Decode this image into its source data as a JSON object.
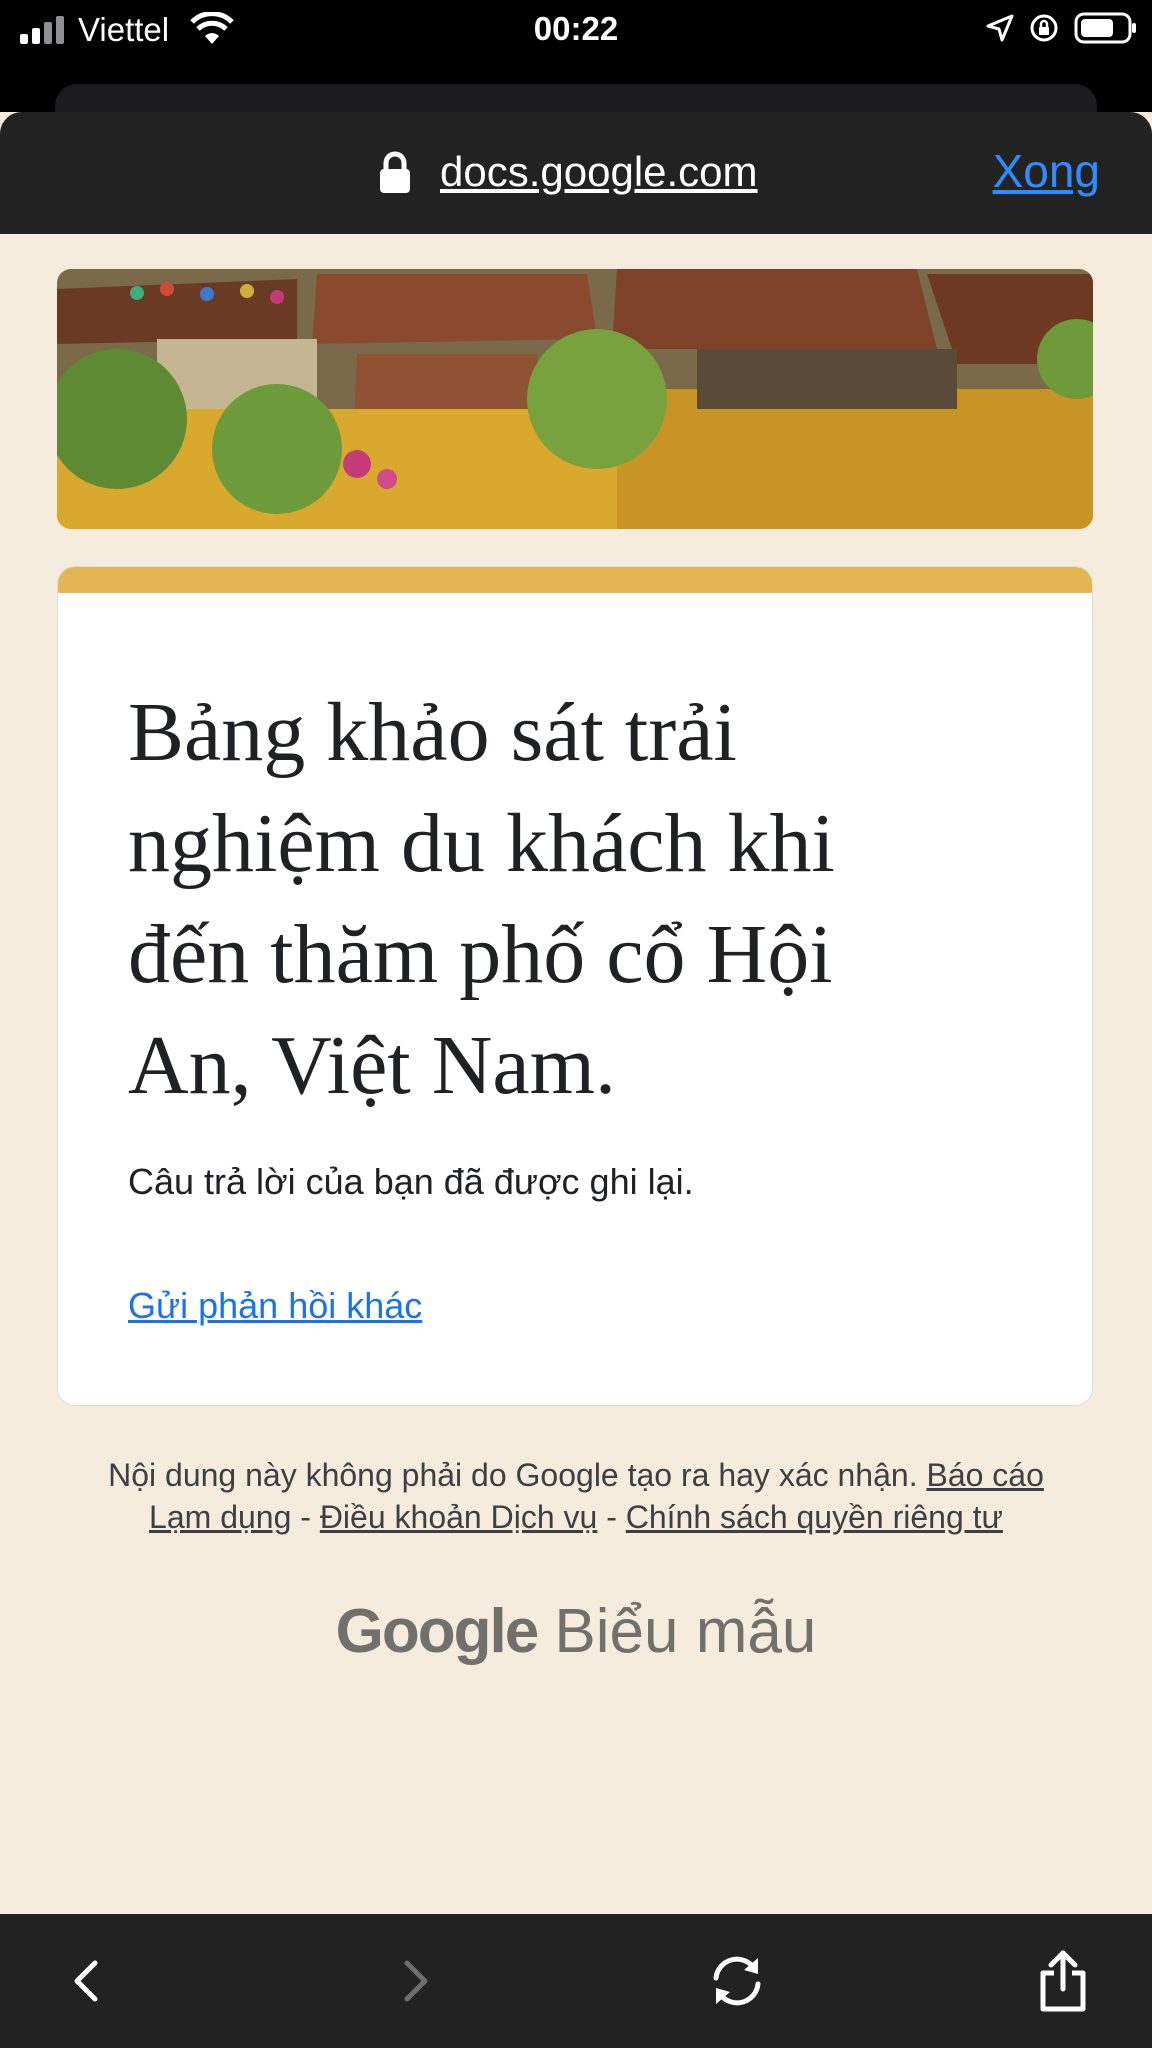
{
  "status_bar": {
    "carrier": "Viettel",
    "time": "00:22"
  },
  "browser": {
    "url": "docs.google.com",
    "done_label": "Xong"
  },
  "form": {
    "title": "Bảng khảo sát trải nghiệm du khách khi đến thăm phố cổ Hội An, Việt Nam.",
    "confirmation": "Câu trả lời của bạn đã được ghi lại.",
    "submit_another": "Gửi phản hồi khác",
    "accent_color": "#e3b553"
  },
  "footer": {
    "disclaimer": "Nội dung này không phải do Google tạo ra hay xác nhận.",
    "report_abuse": "Báo cáo Lạm dụng",
    "sep": " - ",
    "terms": "Điều khoản Dịch vụ",
    "privacy": "Chính sách quyền riêng tư"
  },
  "branding": {
    "google": "Google",
    "product": "Biểu mẫu"
  },
  "toolbar": {
    "icons": [
      "back-icon",
      "forward-icon",
      "reload-icon",
      "share-icon"
    ]
  }
}
